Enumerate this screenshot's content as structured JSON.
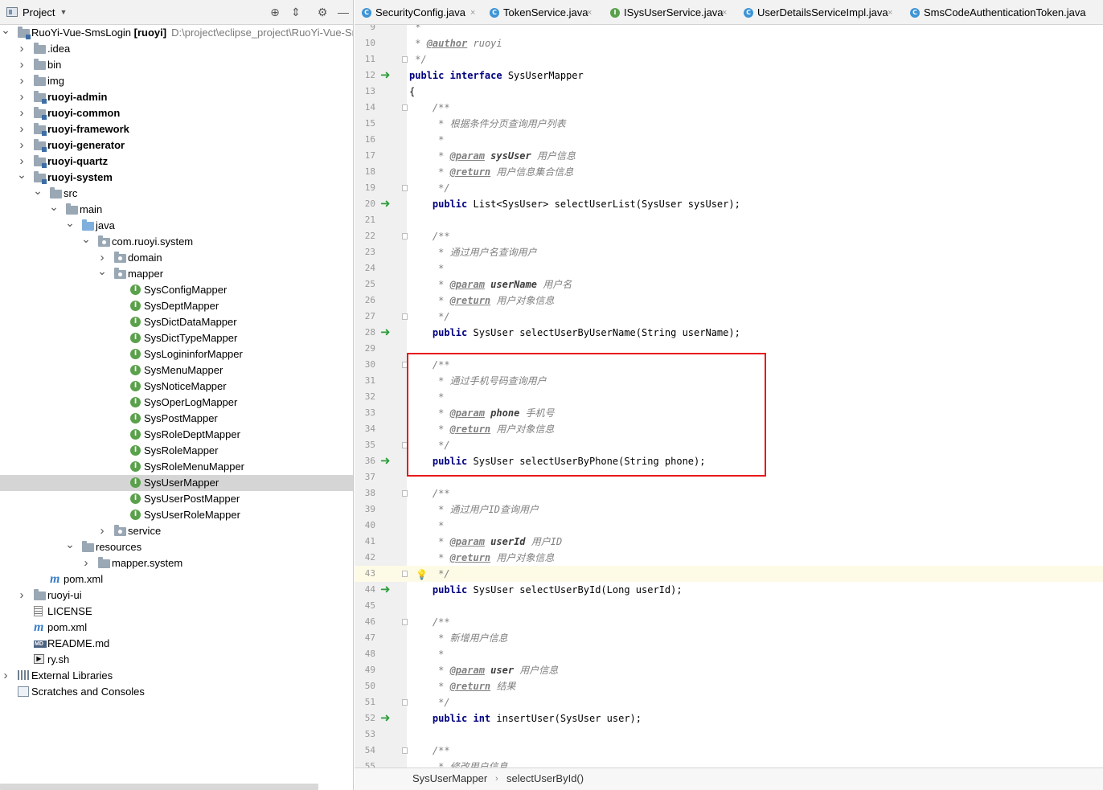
{
  "project_panel": {
    "title": "Project",
    "tree": [
      {
        "label": "RuoYi-Vue-SmsLogin [ruoyi]",
        "extra": "D:\\project\\eclipse_project\\RuoYi-Vue-SmsLogin",
        "depth": 0,
        "arrow": "down",
        "icon": "module-icon",
        "bold": false
      },
      {
        "label": ".idea",
        "depth": 1,
        "arrow": "right",
        "icon": "folder-icon"
      },
      {
        "label": "bin",
        "depth": 1,
        "arrow": "right",
        "icon": "folder-icon"
      },
      {
        "label": "img",
        "depth": 1,
        "arrow": "right",
        "icon": "folder-icon"
      },
      {
        "label": "ruoyi-admin",
        "depth": 1,
        "arrow": "right",
        "icon": "module-folder-icon",
        "bold": true
      },
      {
        "label": "ruoyi-common",
        "depth": 1,
        "arrow": "right",
        "icon": "module-folder-icon",
        "bold": true
      },
      {
        "label": "ruoyi-framework",
        "depth": 1,
        "arrow": "right",
        "icon": "module-folder-icon",
        "bold": true
      },
      {
        "label": "ruoyi-generator",
        "depth": 1,
        "arrow": "right",
        "icon": "module-folder-icon",
        "bold": true
      },
      {
        "label": "ruoyi-quartz",
        "depth": 1,
        "arrow": "right",
        "icon": "module-folder-icon",
        "bold": true
      },
      {
        "label": "ruoyi-system",
        "depth": 1,
        "arrow": "down",
        "icon": "module-folder-icon",
        "bold": true
      },
      {
        "label": "src",
        "depth": 2,
        "arrow": "down",
        "icon": "folder-icon"
      },
      {
        "label": "main",
        "depth": 3,
        "arrow": "down",
        "icon": "folder-icon"
      },
      {
        "label": "java",
        "depth": 4,
        "arrow": "down",
        "icon": "source-folder-icon"
      },
      {
        "label": "com.ruoyi.system",
        "depth": 5,
        "arrow": "down",
        "icon": "package-icon"
      },
      {
        "label": "domain",
        "depth": 6,
        "arrow": "right",
        "icon": "package-icon"
      },
      {
        "label": "mapper",
        "depth": 6,
        "arrow": "down",
        "icon": "package-icon"
      },
      {
        "label": "SysConfigMapper",
        "depth": 7,
        "arrow": "",
        "icon": "interface-icon"
      },
      {
        "label": "SysDeptMapper",
        "depth": 7,
        "arrow": "",
        "icon": "interface-icon"
      },
      {
        "label": "SysDictDataMapper",
        "depth": 7,
        "arrow": "",
        "icon": "interface-icon"
      },
      {
        "label": "SysDictTypeMapper",
        "depth": 7,
        "arrow": "",
        "icon": "interface-icon"
      },
      {
        "label": "SysLogininforMapper",
        "depth": 7,
        "arrow": "",
        "icon": "interface-icon"
      },
      {
        "label": "SysMenuMapper",
        "depth": 7,
        "arrow": "",
        "icon": "interface-icon"
      },
      {
        "label": "SysNoticeMapper",
        "depth": 7,
        "arrow": "",
        "icon": "interface-icon"
      },
      {
        "label": "SysOperLogMapper",
        "depth": 7,
        "arrow": "",
        "icon": "interface-icon"
      },
      {
        "label": "SysPostMapper",
        "depth": 7,
        "arrow": "",
        "icon": "interface-icon"
      },
      {
        "label": "SysRoleDeptMapper",
        "depth": 7,
        "arrow": "",
        "icon": "interface-icon"
      },
      {
        "label": "SysRoleMapper",
        "depth": 7,
        "arrow": "",
        "icon": "interface-icon"
      },
      {
        "label": "SysRoleMenuMapper",
        "depth": 7,
        "arrow": "",
        "icon": "interface-icon"
      },
      {
        "label": "SysUserMapper",
        "depth": 7,
        "arrow": "",
        "icon": "interface-icon",
        "selected": true
      },
      {
        "label": "SysUserPostMapper",
        "depth": 7,
        "arrow": "",
        "icon": "interface-icon"
      },
      {
        "label": "SysUserRoleMapper",
        "depth": 7,
        "arrow": "",
        "icon": "interface-icon"
      },
      {
        "label": "service",
        "depth": 6,
        "arrow": "right",
        "icon": "package-icon"
      },
      {
        "label": "resources",
        "depth": 4,
        "arrow": "down",
        "icon": "resources-folder-icon"
      },
      {
        "label": "mapper.system",
        "depth": 5,
        "arrow": "right",
        "icon": "folder-icon"
      },
      {
        "label": "pom.xml",
        "depth": 2,
        "arrow": "",
        "icon": "maven-icon"
      },
      {
        "label": "ruoyi-ui",
        "depth": 1,
        "arrow": "right",
        "icon": "folder-icon"
      },
      {
        "label": "LICENSE",
        "depth": 1,
        "arrow": "",
        "icon": "text-file-icon"
      },
      {
        "label": "pom.xml",
        "depth": 1,
        "arrow": "",
        "icon": "maven-icon"
      },
      {
        "label": "README.md",
        "depth": 1,
        "arrow": "",
        "icon": "markdown-icon"
      },
      {
        "label": "ry.sh",
        "depth": 1,
        "arrow": "",
        "icon": "shell-icon"
      },
      {
        "label": "External Libraries",
        "depth": 0,
        "arrow": "right",
        "icon": "libraries-icon"
      },
      {
        "label": "Scratches and Consoles",
        "depth": 0,
        "arrow": "",
        "icon": "scratches-icon"
      }
    ]
  },
  "tabs": [
    {
      "label": "SecurityConfig.java",
      "icon": "class-icon"
    },
    {
      "label": "TokenService.java",
      "icon": "class-icon"
    },
    {
      "label": "ISysUserService.java",
      "icon": "interface-icon"
    },
    {
      "label": "UserDetailsServiceImpl.java",
      "icon": "class-icon"
    },
    {
      "label": "SmsCodeAuthenticationToken.java",
      "icon": "class-icon"
    }
  ],
  "editor": {
    "current_line": 43,
    "lines": [
      {
        "n": "9",
        "segs": [
          [
            "cm",
            " *"
          ]
        ]
      },
      {
        "n": "10",
        "segs": [
          [
            "cm",
            " * "
          ],
          [
            "tg",
            "@author"
          ],
          [
            "cm",
            " ruoyi"
          ]
        ]
      },
      {
        "n": "11",
        "segs": [
          [
            "cm",
            " */"
          ]
        ],
        "fold": true
      },
      {
        "n": "12",
        "segs": [
          [
            "kw",
            "public interface"
          ],
          [
            "",
            " SysUserMapper"
          ]
        ],
        "impl": true
      },
      {
        "n": "13",
        "segs": [
          [
            "",
            "{"
          ]
        ]
      },
      {
        "n": "14",
        "segs": [
          [
            "cm",
            "    /**"
          ]
        ],
        "fold": true
      },
      {
        "n": "15",
        "segs": [
          [
            "cm",
            "     * 根据条件分页查询用户列表"
          ]
        ]
      },
      {
        "n": "16",
        "segs": [
          [
            "cm",
            "     *"
          ]
        ]
      },
      {
        "n": "17",
        "segs": [
          [
            "cm",
            "     * "
          ],
          [
            "tg",
            "@param"
          ],
          [
            "",
            " "
          ],
          [
            "pn",
            "sysUser"
          ],
          [
            "cm",
            " 用户信息"
          ]
        ]
      },
      {
        "n": "18",
        "segs": [
          [
            "cm",
            "     * "
          ],
          [
            "tg",
            "@return"
          ],
          [
            "cm",
            " 用户信息集合信息"
          ]
        ]
      },
      {
        "n": "19",
        "segs": [
          [
            "cm",
            "     */"
          ]
        ],
        "fold": true
      },
      {
        "n": "20",
        "segs": [
          [
            "",
            "    "
          ],
          [
            "kw",
            "public"
          ],
          [
            "",
            " List<SysUser> selectUserList(SysUser sysUser);"
          ]
        ],
        "impl": true
      },
      {
        "n": "21",
        "segs": []
      },
      {
        "n": "22",
        "segs": [
          [
            "cm",
            "    /**"
          ]
        ],
        "fold": true
      },
      {
        "n": "23",
        "segs": [
          [
            "cm",
            "     * 通过用户名查询用户"
          ]
        ]
      },
      {
        "n": "24",
        "segs": [
          [
            "cm",
            "     *"
          ]
        ]
      },
      {
        "n": "25",
        "segs": [
          [
            "cm",
            "     * "
          ],
          [
            "tg",
            "@param"
          ],
          [
            "",
            " "
          ],
          [
            "pn",
            "userName"
          ],
          [
            "cm",
            " 用户名"
          ]
        ]
      },
      {
        "n": "26",
        "segs": [
          [
            "cm",
            "     * "
          ],
          [
            "tg",
            "@return"
          ],
          [
            "cm",
            " 用户对象信息"
          ]
        ]
      },
      {
        "n": "27",
        "segs": [
          [
            "cm",
            "     */"
          ]
        ],
        "fold": true
      },
      {
        "n": "28",
        "segs": [
          [
            "",
            "    "
          ],
          [
            "kw",
            "public"
          ],
          [
            "",
            " SysUser selectUserByUserName(String userName);"
          ]
        ],
        "impl": true
      },
      {
        "n": "29",
        "segs": []
      },
      {
        "n": "30",
        "segs": [
          [
            "cm",
            "    /**"
          ]
        ],
        "fold": true
      },
      {
        "n": "31",
        "segs": [
          [
            "cm",
            "     * 通过手机号码查询用户"
          ]
        ]
      },
      {
        "n": "32",
        "segs": [
          [
            "cm",
            "     *"
          ]
        ]
      },
      {
        "n": "33",
        "segs": [
          [
            "cm",
            "     * "
          ],
          [
            "tg",
            "@param"
          ],
          [
            "",
            " "
          ],
          [
            "pn",
            "phone"
          ],
          [
            "cm",
            " 手机号"
          ]
        ]
      },
      {
        "n": "34",
        "segs": [
          [
            "cm",
            "     * "
          ],
          [
            "tg",
            "@return"
          ],
          [
            "cm",
            " 用户对象信息"
          ]
        ]
      },
      {
        "n": "35",
        "segs": [
          [
            "cm",
            "     */"
          ]
        ],
        "fold": true
      },
      {
        "n": "36",
        "segs": [
          [
            "",
            "    "
          ],
          [
            "kw",
            "public"
          ],
          [
            "",
            " SysUser selectUserByPhone(String phone);"
          ]
        ],
        "impl": true
      },
      {
        "n": "37",
        "segs": []
      },
      {
        "n": "38",
        "segs": [
          [
            "cm",
            "    /**"
          ]
        ],
        "fold": true
      },
      {
        "n": "39",
        "segs": [
          [
            "cm",
            "     * 通过用户ID查询用户"
          ]
        ]
      },
      {
        "n": "40",
        "segs": [
          [
            "cm",
            "     *"
          ]
        ]
      },
      {
        "n": "41",
        "segs": [
          [
            "cm",
            "     * "
          ],
          [
            "tg",
            "@param"
          ],
          [
            "",
            " "
          ],
          [
            "pn",
            "userId"
          ],
          [
            "cm",
            " 用户ID"
          ]
        ]
      },
      {
        "n": "42",
        "segs": [
          [
            "cm",
            "     * "
          ],
          [
            "tg",
            "@return"
          ],
          [
            "cm",
            " 用户对象信息"
          ]
        ]
      },
      {
        "n": "43",
        "segs": [
          [
            "cm",
            "     */"
          ]
        ],
        "fold": true,
        "bulb": true
      },
      {
        "n": "44",
        "segs": [
          [
            "",
            "    "
          ],
          [
            "kw",
            "public"
          ],
          [
            "",
            " SysUser selectUserById(Long userId);"
          ]
        ],
        "impl": true
      },
      {
        "n": "45",
        "segs": []
      },
      {
        "n": "46",
        "segs": [
          [
            "cm",
            "    /**"
          ]
        ],
        "fold": true
      },
      {
        "n": "47",
        "segs": [
          [
            "cm",
            "     * 新增用户信息"
          ]
        ]
      },
      {
        "n": "48",
        "segs": [
          [
            "cm",
            "     *"
          ]
        ]
      },
      {
        "n": "49",
        "segs": [
          [
            "cm",
            "     * "
          ],
          [
            "tg",
            "@param"
          ],
          [
            "",
            " "
          ],
          [
            "pn",
            "user"
          ],
          [
            "cm",
            " 用户信息"
          ]
        ]
      },
      {
        "n": "50",
        "segs": [
          [
            "cm",
            "     * "
          ],
          [
            "tg",
            "@return"
          ],
          [
            "cm",
            " 结果"
          ]
        ]
      },
      {
        "n": "51",
        "segs": [
          [
            "cm",
            "     */"
          ]
        ],
        "fold": true
      },
      {
        "n": "52",
        "segs": [
          [
            "",
            "    "
          ],
          [
            "kw",
            "public int"
          ],
          [
            "",
            " insertUser(SysUser user);"
          ]
        ],
        "impl": true
      },
      {
        "n": "53",
        "segs": []
      },
      {
        "n": "54",
        "segs": [
          [
            "cm",
            "    /**"
          ]
        ],
        "fold": true
      },
      {
        "n": "55",
        "segs": [
          [
            "cm",
            "     * 修改用户信息"
          ]
        ]
      }
    ]
  },
  "breadcrumb": [
    "SysUserMapper",
    "selectUserById()"
  ],
  "colors": {
    "highlight_border": "#e8191b",
    "gutter_arrow": "#2d9e3a",
    "keyword": "#000080",
    "comment": "#808080"
  }
}
